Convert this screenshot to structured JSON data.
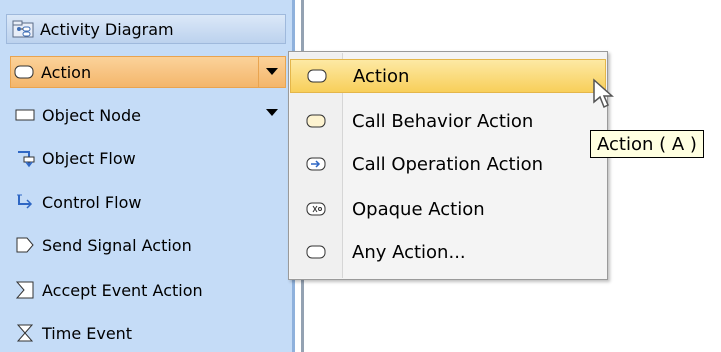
{
  "palette": {
    "header": {
      "label": "Activity Diagram",
      "icon": "activity-diagram-icon"
    },
    "items": [
      {
        "label": "Action",
        "icon": "action-icon",
        "has_dropdown": true,
        "selected": true
      },
      {
        "label": "Object Node",
        "icon": "object-node-icon",
        "has_dropdown": true
      },
      {
        "label": "Object Flow",
        "icon": "object-flow-icon"
      },
      {
        "label": "Control Flow",
        "icon": "control-flow-icon"
      },
      {
        "label": "Send Signal Action",
        "icon": "send-signal-icon"
      },
      {
        "label": "Accept Event Action",
        "icon": "accept-event-icon"
      },
      {
        "label": "Time Event",
        "icon": "time-event-icon"
      }
    ]
  },
  "menu": {
    "items": [
      {
        "label": "Action",
        "icon": "action-icon",
        "highlighted": true
      },
      {
        "label": "Call Behavior Action",
        "icon": "call-behavior-icon"
      },
      {
        "label": "Call Operation Action",
        "icon": "call-operation-icon"
      },
      {
        "label": "Opaque Action",
        "icon": "opaque-action-icon"
      },
      {
        "label": "Any Action...",
        "icon": "any-action-icon"
      }
    ]
  },
  "tooltip": {
    "text": "Action ( A )"
  },
  "colors": {
    "palette_bg": "#c5dcf7",
    "selected_bg": "#f4b66b",
    "menu_highlight": "#f8cf5a",
    "tooltip_bg": "#ffffe1"
  }
}
